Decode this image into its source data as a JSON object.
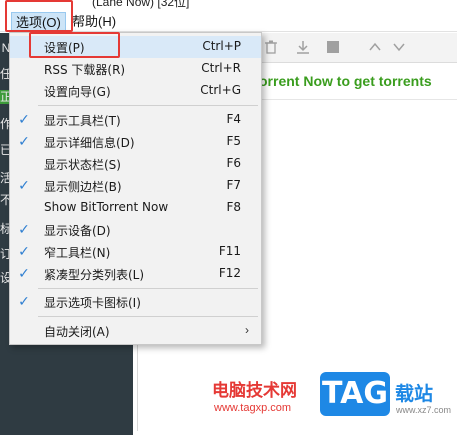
{
  "titlebar": {
    "text": "(Lane Now) [32位]"
  },
  "menubar": {
    "options_label": "选项(O)",
    "help_label": "帮助(H)"
  },
  "sidebar": {
    "strip_chars": [
      "N",
      "任",
      "正",
      "作",
      "已",
      "活",
      "不",
      "标",
      "订",
      "设"
    ]
  },
  "toolbar": {
    "icons": [
      "delete-icon",
      "download-icon",
      "stop-icon",
      "arrow-up-icon",
      "arrow-down-icon"
    ]
  },
  "promo": {
    "text": "orrent Now to get torrents"
  },
  "options_menu": {
    "items": [
      {
        "label": "设置(P)",
        "shortcut": "Ctrl+P",
        "checked": false
      },
      {
        "label": "RSS 下载器(R)",
        "shortcut": "Ctrl+R",
        "checked": false
      },
      {
        "label": "设置向导(G)",
        "shortcut": "Ctrl+G",
        "checked": false
      },
      {
        "label": "显示工具栏(T)",
        "shortcut": "F4",
        "checked": true
      },
      {
        "label": "显示详细信息(D)",
        "shortcut": "F5",
        "checked": true
      },
      {
        "label": "显示状态栏(S)",
        "shortcut": "F6",
        "checked": false
      },
      {
        "label": "显示侧边栏(B)",
        "shortcut": "F7",
        "checked": true
      },
      {
        "label": "Show BitTorrent Now",
        "shortcut": "F8",
        "checked": false
      },
      {
        "label": "显示设备(D)",
        "shortcut": "",
        "checked": true
      },
      {
        "label": "窄工具栏(N)",
        "shortcut": "F11",
        "checked": true
      },
      {
        "label": "紧凑型分类列表(L)",
        "shortcut": "F12",
        "checked": true
      },
      {
        "label": "显示选项卡图标(I)",
        "shortcut": "",
        "checked": true
      },
      {
        "label": "自动关闭(A)",
        "shortcut": "",
        "checked": false,
        "submenu": true
      }
    ]
  },
  "watermark": {
    "cn_text": "电脑技术网",
    "url": "www.tagxp.com",
    "logo_text": "TAG",
    "site_text": "载站",
    "site_url": "www.xz7.com"
  },
  "colors": {
    "sidebar_bg": "#2f3b42",
    "check_blue": "#2f7fd1",
    "promo_green": "#3a9d1e",
    "annotation_red": "#e53935",
    "logo_blue": "#1e88e5"
  }
}
